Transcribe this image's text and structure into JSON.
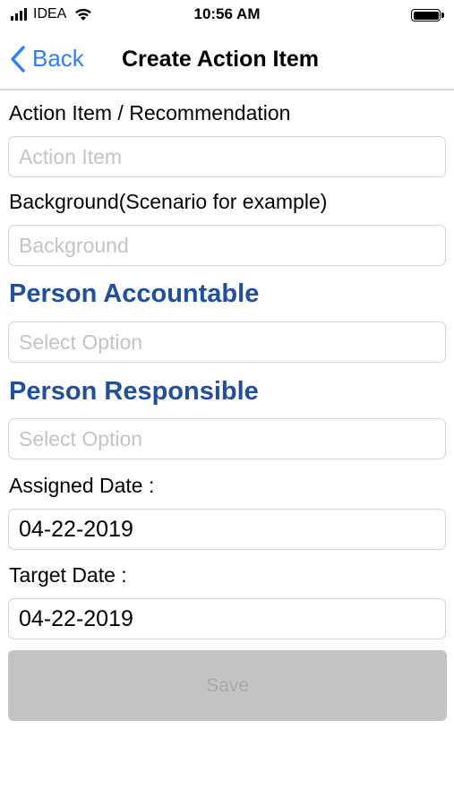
{
  "status_bar": {
    "carrier": "IDEA",
    "time": "10:56 AM"
  },
  "nav": {
    "back_label": "Back",
    "title": "Create Action Item"
  },
  "form": {
    "action_item": {
      "label": "Action Item / Recommendation",
      "placeholder": "Action Item",
      "value": ""
    },
    "background": {
      "label": "Background(Scenario for example)",
      "placeholder": "Background",
      "value": ""
    },
    "person_accountable": {
      "label": "Person Accountable",
      "placeholder": "Select Option"
    },
    "person_responsible": {
      "label": "Person Responsible",
      "placeholder": "Select Option"
    },
    "assigned_date": {
      "label": "Assigned Date :",
      "value": "04-22-2019"
    },
    "target_date": {
      "label": "Target Date :",
      "value": "04-22-2019"
    }
  },
  "save_button": {
    "label": "Save",
    "enabled": false
  },
  "colors": {
    "accent": "#2f7ff3",
    "section_heading": "#1f4f9e",
    "placeholder": "#c3c3c8",
    "disabled_button": "#c3c3c3"
  },
  "icons": {
    "back": "chevron-left-icon",
    "signal": "cellular-signal-icon",
    "wifi": "wifi-icon",
    "battery": "battery-icon"
  }
}
